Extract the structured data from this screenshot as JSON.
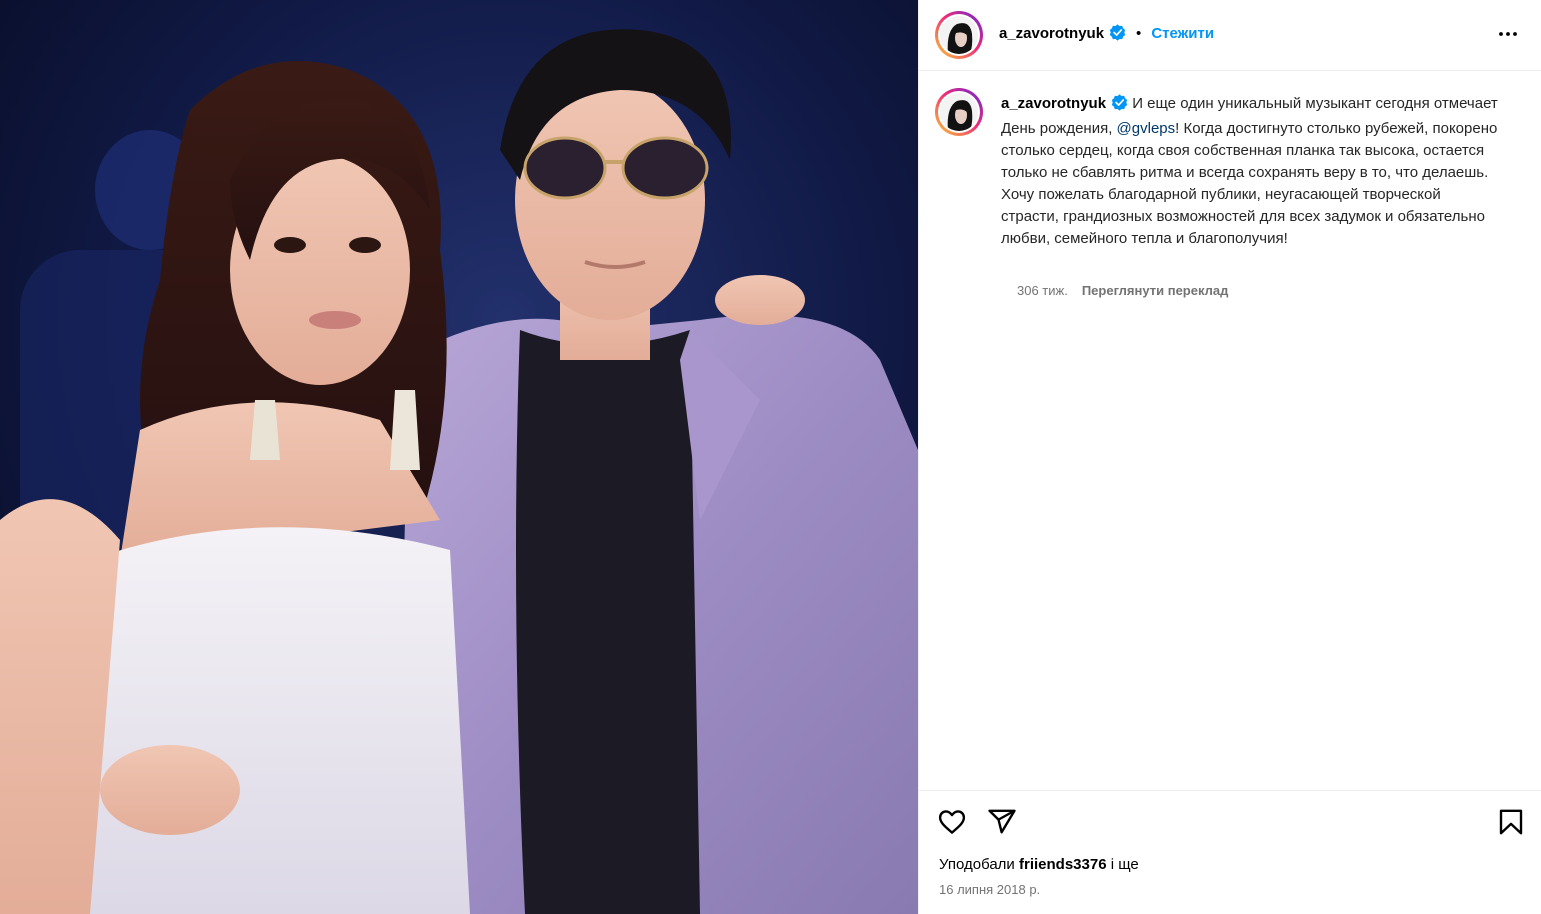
{
  "post": {
    "username": "a_zavorotnyuk",
    "follow_label": "Стежити",
    "separator": "•",
    "caption_before_mention": "И еще один уникальный музыкант сегодня отмечает День рождения, ",
    "mention": "@gvleps",
    "caption_after_mention": "! Когда достигнуто столько рубежей, покорено столько сердец, когда своя собственная планка так высока, остается только не сбавлять ритма и всегда сохранять веру в то, что делаешь. Хочу пожелать благодарной публики, неугасающей творческой страсти, грандиозных возможностей для всех задумок и обязательно любви, семейного тепла и благополучия!",
    "time_ago": "306 тиж.",
    "see_translation": "Переглянути переклад",
    "likes_prefix": "Уподобали",
    "liked_by": "friiends3376",
    "likes_suffix": "і ще",
    "date": "16 липня 2018 р."
  },
  "icons": {
    "verified": "verified-badge-icon",
    "more": "more-options-icon",
    "like": "heart-icon",
    "share": "share-icon",
    "save": "bookmark-icon"
  },
  "colors": {
    "follow": "#0095f6",
    "mention": "#00376b",
    "verified": "#0095f6",
    "muted": "#737373"
  }
}
